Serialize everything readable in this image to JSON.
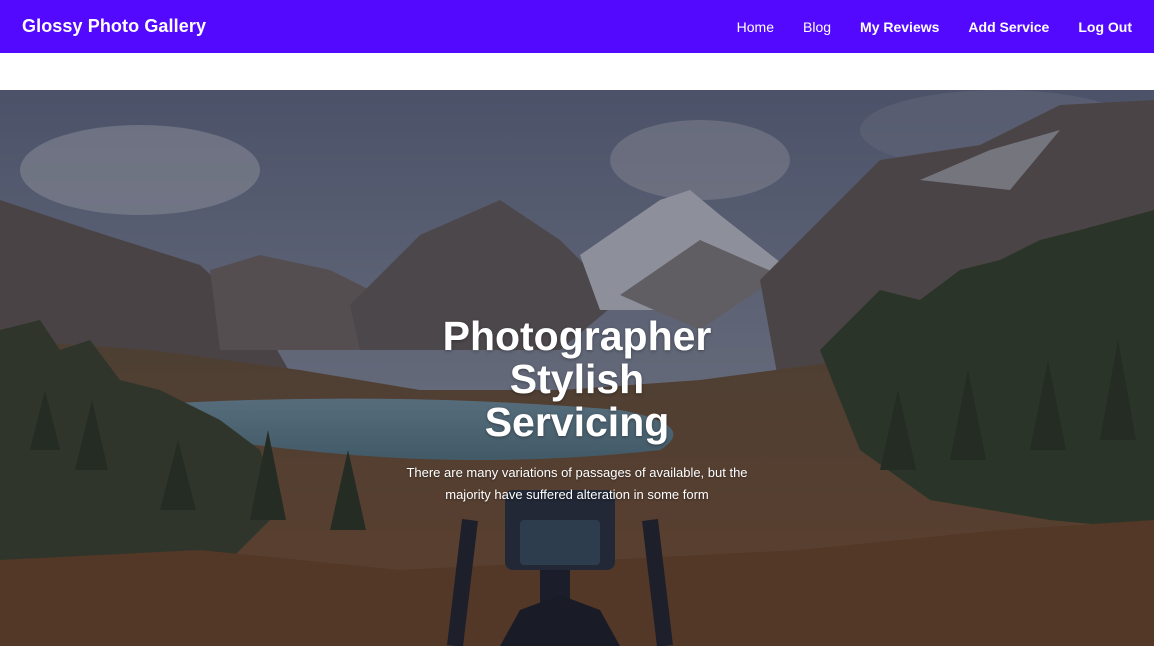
{
  "navbar": {
    "brand": "Glossy Photo Gallery",
    "links": [
      {
        "label": "Home"
      },
      {
        "label": "Blog"
      },
      {
        "label": "My Reviews"
      },
      {
        "label": "Add Service"
      },
      {
        "label": "Log Out"
      }
    ]
  },
  "hero": {
    "title": "Photographer Stylish Servicing",
    "subtitle": "There are many variations of passages of available, but the majority have suffered alteration in some form"
  },
  "colors": {
    "navbar_background": "#5409ff",
    "text": "#ffffff"
  }
}
